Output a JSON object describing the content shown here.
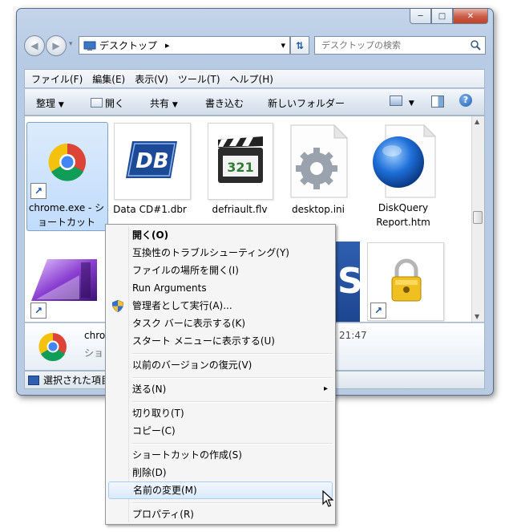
{
  "window": {
    "minimize": "─",
    "maximize": "□",
    "close": "✕"
  },
  "address": {
    "location": "デスクトップ",
    "separator": "▸",
    "dropdown": "▾"
  },
  "search": {
    "placeholder": "デスクトップの検索"
  },
  "menubar": [
    "ファイル(F)",
    "編集(E)",
    "表示(V)",
    "ツール(T)",
    "ヘルプ(H)"
  ],
  "toolbar": {
    "organize": "整理",
    "open": "開く",
    "share": "共有",
    "burn": "書き込む",
    "new_folder": "新しいフォルダー"
  },
  "files": [
    {
      "line1": "chrome.exe - シ",
      "line2": "ョートカット"
    },
    {
      "line1": "Data CD#1.dbr",
      "line2": ""
    },
    {
      "line1": "defriault.flv",
      "line2": ""
    },
    {
      "line1": "desktop.ini",
      "line2": ""
    },
    {
      "line1": "DiskQuery",
      "line2": "Report.htm"
    }
  ],
  "file_icons": {
    "db_text": "DB",
    "clapper_text": "321",
    "lock_badge": "S"
  },
  "details": {
    "name": "chrome",
    "type": "ショ",
    "time": "21:47"
  },
  "status": {
    "text": "選択された項目"
  },
  "context_menu": {
    "open": "開く(O)",
    "compat": "互換性のトラブルシューティング(Y)",
    "open_location": "ファイルの場所を開く(I)",
    "run_args": "Run Arguments",
    "run_admin": "管理者として実行(A)...",
    "pin_taskbar": "タスク バーに表示する(K)",
    "pin_start": "スタート メニューに表示する(U)",
    "restore": "以前のバージョンの復元(V)",
    "send_to": "送る(N)",
    "cut": "切り取り(T)",
    "copy": "コピー(C)",
    "create_shortcut": "ショートカットの作成(S)",
    "delete": "削除(D)",
    "rename": "名前の変更(M)",
    "properties": "プロパティ(R)",
    "submenu_arrow": "▸"
  }
}
